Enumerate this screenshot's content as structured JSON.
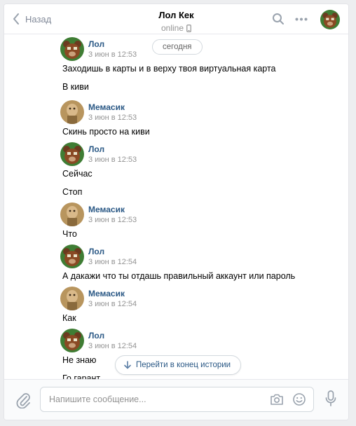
{
  "header": {
    "back_label": "Назад",
    "title": "Лол Кек",
    "status": "online"
  },
  "history": {
    "date_pill": "сегодня",
    "goto_end": "Перейти в конец истории",
    "groups": [
      {
        "author": "Лол",
        "time": "3 июн в 12:53",
        "avatar": "bear-avatar",
        "messages": [
          "Заходишь в карты и в верху твоя виртуальная карта",
          "В киви"
        ]
      },
      {
        "author": "Мемасик",
        "time": "3 июн в 12:53",
        "avatar": "meme-avatar",
        "messages": [
          "Скинь просто на киви"
        ]
      },
      {
        "author": "Лол",
        "time": "3 июн в 12:53",
        "avatar": "bear-avatar",
        "messages": [
          "Сейчас",
          "Стоп"
        ]
      },
      {
        "author": "Мемасик",
        "time": "3 июн в 12:53",
        "avatar": "meme-avatar",
        "messages": [
          "Что"
        ]
      },
      {
        "author": "Лол",
        "time": "3 июн в 12:54",
        "avatar": "bear-avatar",
        "messages": [
          "А дакажи что ты отдашь правильный аккаунт или пароль"
        ]
      },
      {
        "author": "Мемасик",
        "time": "3 июн в 12:54",
        "avatar": "meme-avatar",
        "messages": [
          "Как"
        ]
      },
      {
        "author": "Лол",
        "time": "3 июн в 12:54",
        "avatar": "bear-avatar",
        "messages": [
          "Не знаю",
          "Го гарант"
        ]
      }
    ]
  },
  "composer": {
    "placeholder": "Напишите сообщение..."
  },
  "colors": {
    "link": "#2a5885",
    "muted": "#939393",
    "icon": "#99a2ad"
  }
}
